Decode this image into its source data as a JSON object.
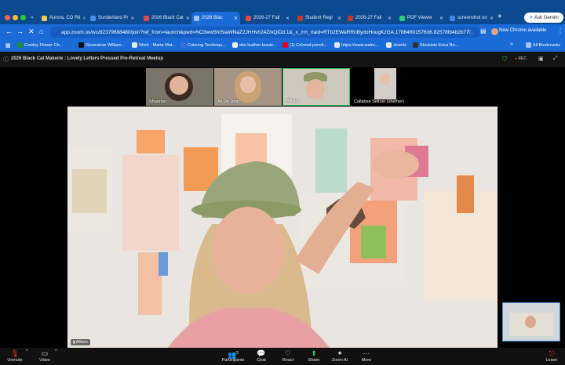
{
  "browser": {
    "tabs": [
      {
        "label": "Aurora, CO Rit",
        "color": "#f2c94c"
      },
      {
        "label": "Sunderland Pr",
        "color": "#4a90e2"
      },
      {
        "label": "2026 Black Cat",
        "color": "#e04a4a"
      },
      {
        "label": "2026 Blac",
        "color": "#4a90e2"
      },
      {
        "label": "2026-27 Fall",
        "color": "#e04a4a"
      },
      {
        "label": "Student Regi",
        "color": "#c0392b"
      },
      {
        "label": "2026-27 Fall",
        "color": "#c0392b"
      },
      {
        "label": "PDF Viewer",
        "color": "#2ecc71"
      },
      {
        "label": "screenshot on",
        "color": "#4285f4"
      }
    ],
    "ask_gemini": "Ask Gemini",
    "url": "app.zoom.us/wc/82379688480/join?ref_from=launch&pwd=NO3ww5hISiaWNaZ2JHHvh24ZlnQiDd.1&_x_zm_rtaid=RTb2EWaRRnBydoHougKzGA.1786460157606.82578fb4b2b77...",
    "new_chrome": "New Chrome available",
    "bookmarks": [
      "Cowley Flower Ch...",
      "Genevieve William...",
      "Work - Marta Mat...",
      "Coloring Techniqu...",
      "eko leather tassie...",
      "(1) Colored pencil...",
      "https://www.walm...",
      "Jewels",
      "Stockists-Erica Be..."
    ],
    "all_bookmarks": "All Bookmarks"
  },
  "meeting": {
    "title": "2026 Black Cat Makerie : Lovely Letters Pressed Pre-Retreat Meetup",
    "rec": "REC",
    "participants": [
      "Shannon",
      "Ali De John",
      "Allison",
      "Callahan Seltzer (she/her)"
    ],
    "speaker": "Allison"
  },
  "toolbar": {
    "unmute": "Unmute",
    "video": "Video",
    "participants": "Participants",
    "participants_count": "5",
    "chat": "Chat",
    "react": "React",
    "share": "Share",
    "zoom_ai": "Zoom AI",
    "more": "More",
    "leave": "Leave"
  },
  "colors": {
    "tab_bar": "#0b4a8f",
    "browser_accent": "#1a6ad8",
    "zoom_bg": "#000000",
    "share_green": "#22c55e"
  }
}
